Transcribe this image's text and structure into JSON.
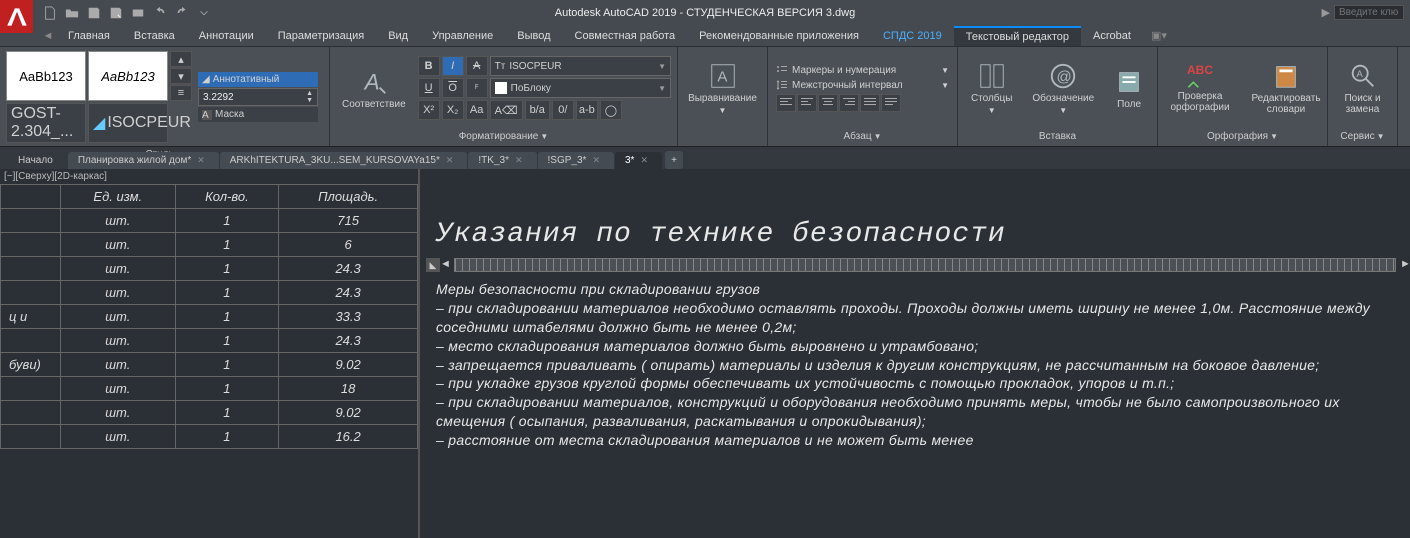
{
  "title": "Autodesk AutoCAD 2019 - СТУДЕНЧЕСКАЯ ВЕРСИЯ    3.dwg",
  "search_placeholder": "Введите клю",
  "menu": {
    "items": [
      "Главная",
      "Вставка",
      "Аннотации",
      "Параметризация",
      "Вид",
      "Управление",
      "Вывод",
      "Совместная работа",
      "Рекомендованные приложения",
      "СПДС 2019",
      "Текстовый редактор",
      "Acrobat"
    ],
    "active": "Текстовый редактор"
  },
  "ribbon": {
    "style": {
      "label": "Стиль",
      "swatch1": "AaBb123",
      "swatch2": "AaBb123",
      "list1": "GOST-2.304_...",
      "list2": "ISOCPEUR",
      "annotative": "Аннотативный",
      "height": "3.2292",
      "mask": "Маска"
    },
    "format": {
      "label": "Форматирование",
      "match": "Соответствие",
      "font": "ISOCPEUR",
      "color": "ПоБлоку",
      "b": "B",
      "i": "I",
      "strike": "A",
      "u": "U",
      "o": "O",
      "over": "O",
      "sub": "x",
      "sup": "X",
      "aa": "Aa",
      "clear": "A"
    },
    "align": {
      "label": "Выравнивание"
    },
    "paragraph": {
      "label": "Абзац",
      "bullets": "Маркеры и нумерация",
      "line": "Межстрочный интервал"
    },
    "insert": {
      "label": "Вставка",
      "col": "Столбцы",
      "sym": "Обозначение",
      "field": "Поле"
    },
    "spell": {
      "label": "Орфография",
      "check": "Проверка орфографии",
      "dict": "Редактировать словари",
      "abc": "ABC"
    },
    "tools": {
      "label": "Сервис",
      "find": "Поиск и замена"
    }
  },
  "filetabs": {
    "start": "Начало",
    "items": [
      "Планировка жилой дом*",
      "ARKhITEKTURA_3KU...SEM_KURSOVAYa15*",
      "!TK_3*",
      "!SGP_3*",
      "3*"
    ],
    "active": "3*"
  },
  "viewstate": "[−][Сверху][2D-каркас]",
  "table": {
    "headers": [
      "Ед. изм.",
      "Кол-во.",
      "Площадь."
    ],
    "rows": [
      {
        "u": "шт.",
        "q": "1",
        "a": "715"
      },
      {
        "u": "шт.",
        "q": "1",
        "a": "6"
      },
      {
        "u": "шт.",
        "q": "1",
        "a": "24.3"
      },
      {
        "u": "шт.",
        "q": "1",
        "a": "24.3"
      },
      {
        "label": "ц и",
        "u": "шт.",
        "q": "1",
        "a": "33.3"
      },
      {
        "u": "шт.",
        "q": "1",
        "a": "24.3"
      },
      {
        "label": "буви)",
        "u": "шт.",
        "q": "1",
        "a": "9.02"
      },
      {
        "u": "шт.",
        "q": "1",
        "a": "18"
      },
      {
        "u": "шт.",
        "q": "1",
        "a": "9.02"
      },
      {
        "u": "шт.",
        "q": "1",
        "a": "16.2"
      }
    ]
  },
  "doc": {
    "title": "Указания по технике безопасности",
    "body": [
      "Меры безопасности при складировании грузов",
      "–     при складировании материалов необходимо оставлять проходы. Проходы должны иметь ширину не менее 1,0м. Расстояние между соседними штабелями должно быть не менее 0,2м;",
      "–     место складирования материалов должно быть выровнено и утрамбовано;",
      "–     запрещается приваливать ( опирать) материалы и изделия к другим конструкциям, не рассчитанным на боковое давление;",
      "–     при укладке грузов круглой формы обеспечивать их устойчивость с помощью прокладок, упоров и т.п.;",
      "–     при складировании материалов, конструкций и оборудования необходимо принять меры, чтобы не было самопроизвольного их смещения ( осыпания, разваливания, раскатывания и опрокидывания);",
      "–     расстояние от места складирования материалов и не может быть менее"
    ]
  }
}
